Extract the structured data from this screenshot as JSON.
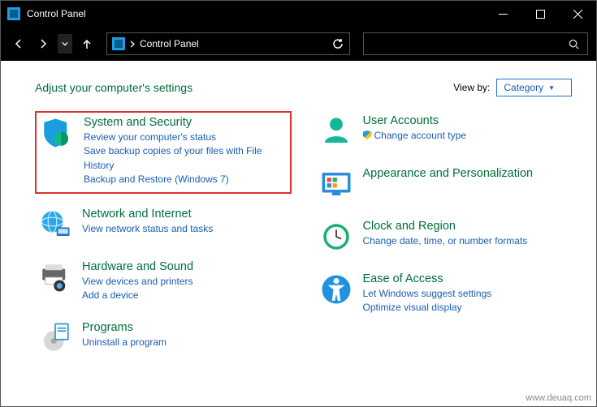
{
  "window": {
    "title": "Control Panel"
  },
  "breadcrumb": {
    "root": "Control Panel"
  },
  "header": {
    "title": "Adjust your computer's settings",
    "viewby_label": "View by:",
    "viewby_value": "Category"
  },
  "left": [
    {
      "title": "System and Security",
      "links": [
        "Review your computer's status",
        "Save backup copies of your files with File History",
        "Backup and Restore (Windows 7)"
      ]
    },
    {
      "title": "Network and Internet",
      "links": [
        "View network status and tasks"
      ]
    },
    {
      "title": "Hardware and Sound",
      "links": [
        "View devices and printers",
        "Add a device"
      ]
    },
    {
      "title": "Programs",
      "links": [
        "Uninstall a program"
      ]
    }
  ],
  "right": [
    {
      "title": "User Accounts",
      "links": [
        "Change account type"
      ],
      "shield": [
        true
      ]
    },
    {
      "title": "Appearance and Personalization",
      "links": []
    },
    {
      "title": "Clock and Region",
      "links": [
        "Change date, time, or number formats"
      ]
    },
    {
      "title": "Ease of Access",
      "links": [
        "Let Windows suggest settings",
        "Optimize visual display"
      ]
    }
  ],
  "watermark": "www.deuaq.com"
}
